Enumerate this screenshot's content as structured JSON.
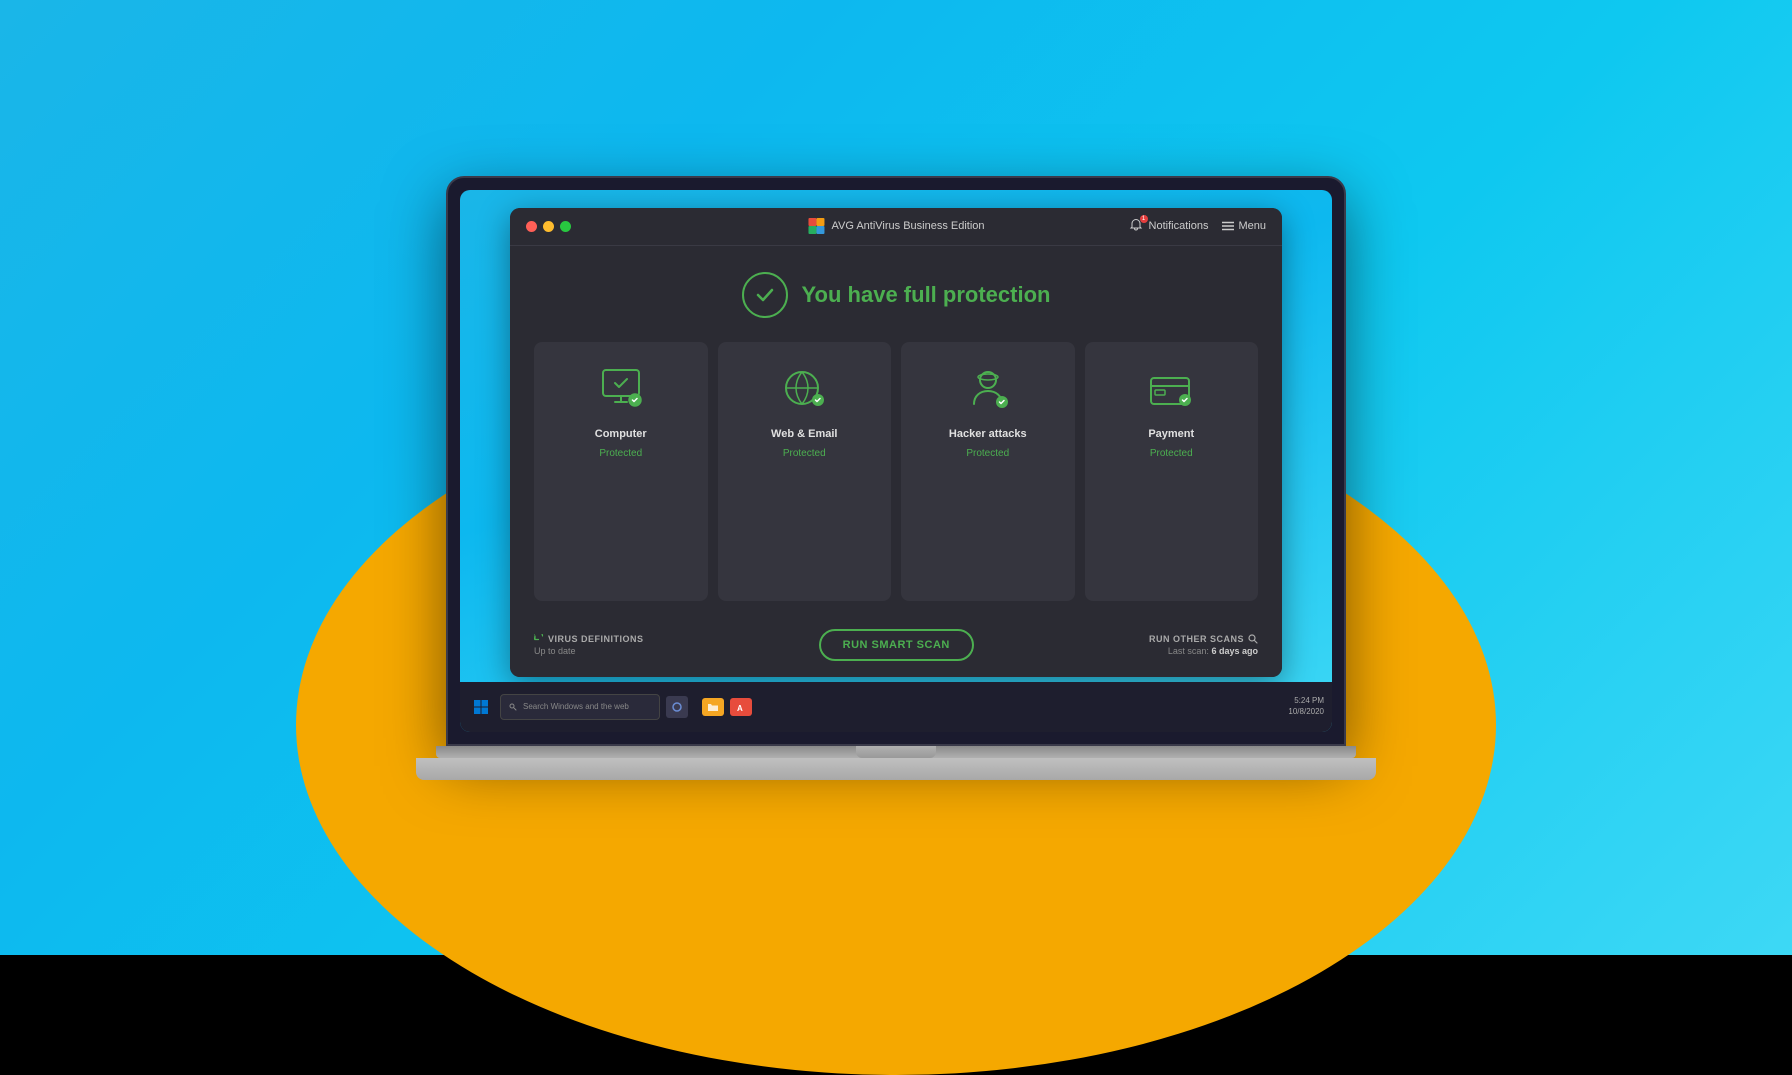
{
  "background": {
    "gradient_start": "#1ab6e8",
    "gradient_end": "#3dd8f5"
  },
  "titlebar": {
    "app_name": "AVG AntiVirus Business Edition",
    "notifications_label": "Notifications",
    "menu_label": "Menu",
    "notification_count": "1"
  },
  "protection": {
    "headline": "You have full protection"
  },
  "cards": [
    {
      "id": "computer",
      "title": "Computer",
      "status": "Protected",
      "icon": "monitor-shield"
    },
    {
      "id": "web-email",
      "title": "Web & Email",
      "status": "Protected",
      "icon": "globe"
    },
    {
      "id": "hacker-attacks",
      "title": "Hacker attacks",
      "status": "Protected",
      "icon": "hacker"
    },
    {
      "id": "payment",
      "title": "Payment",
      "status": "Protected",
      "icon": "credit-card"
    }
  ],
  "bottom_bar": {
    "virus_def_label": "VIRUS DEFINITIONS",
    "virus_def_status": "Up to date",
    "scan_button": "RUN SMART SCAN",
    "other_scans_label": "RUN OTHER SCANS",
    "last_scan_label": "Last scan:",
    "last_scan_value": "6 days ago"
  },
  "taskbar": {
    "search_placeholder": "Search Windows and the web",
    "time": "5:24 PM",
    "date": "10/8/2020"
  }
}
